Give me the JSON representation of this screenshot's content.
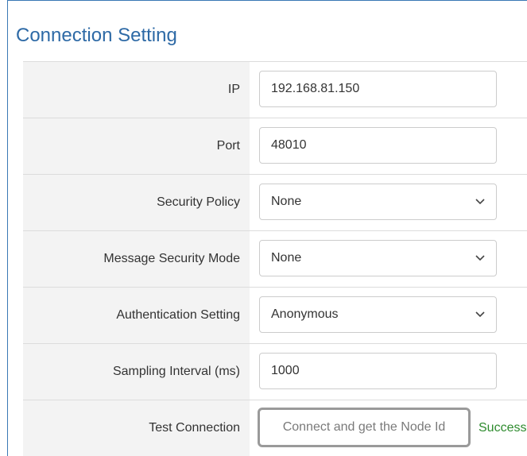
{
  "panel": {
    "title": "Connection Setting"
  },
  "fields": {
    "ip": {
      "label": "IP",
      "value": "192.168.81.150"
    },
    "port": {
      "label": "Port",
      "value": "48010"
    },
    "security_policy": {
      "label": "Security Policy",
      "value": "None",
      "icon": "chevron-down-icon"
    },
    "message_security_mode": {
      "label": "Message Security Mode",
      "value": "None",
      "icon": "chevron-down-icon"
    },
    "authentication_setting": {
      "label": "Authentication Setting",
      "value": "Anonymous",
      "icon": "chevron-down-icon"
    },
    "sampling_interval": {
      "label": "Sampling Interval (ms)",
      "value": "1000"
    },
    "test_connection": {
      "label": "Test Connection",
      "button_label": "Connect and get the Node Id",
      "status": "Success"
    }
  },
  "colors": {
    "title": "#2e6aa6",
    "panel_border": "#3a78b5",
    "label_background": "#f3f3f3",
    "success": "#2e8b2e"
  }
}
